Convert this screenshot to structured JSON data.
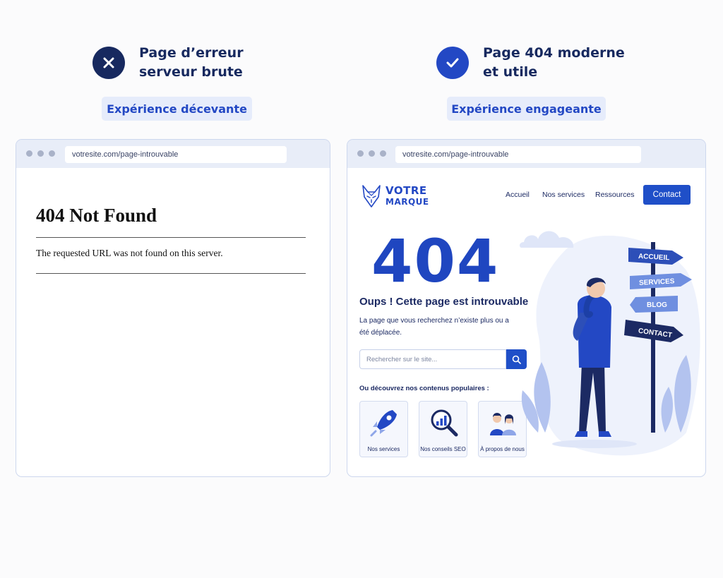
{
  "left": {
    "heading": "Page d’erreur\nserveur brute",
    "pill": "Expérience décevante",
    "icon": "x-circle-icon",
    "url": "votresite.com/page-introuvable",
    "title": "404 Not Found",
    "message": "The requested URL was not found on this server."
  },
  "right": {
    "heading": "Page 404 moderne\net utile",
    "pill": "Expérience engageante",
    "icon": "check-circle-icon",
    "url": "votresite.com/page-introuvable",
    "brand_line1": "VOTRE",
    "brand_line2": "MARQUE",
    "nav": [
      "Accueil",
      "Nos services",
      "Ressources"
    ],
    "contact": "Contact",
    "code": "404",
    "oops": "Oups ! Cette page est introuvable",
    "description": "La page que vous recherchez n’existe plus ou a été déplacée.",
    "search_placeholder": "Rechercher sur le site...",
    "popular_label": "Ou découvrez nos contenus populaires :",
    "cards": [
      "Nos services",
      "Nos conseils SEO",
      "À propos de nous"
    ],
    "signs": [
      "ACCUEIL",
      "SERVICES",
      "BLOG",
      "CONTACT"
    ]
  },
  "colors": {
    "navy": "#17295f",
    "accent": "#2348c4",
    "pill_bg": "#e6ecfb"
  }
}
